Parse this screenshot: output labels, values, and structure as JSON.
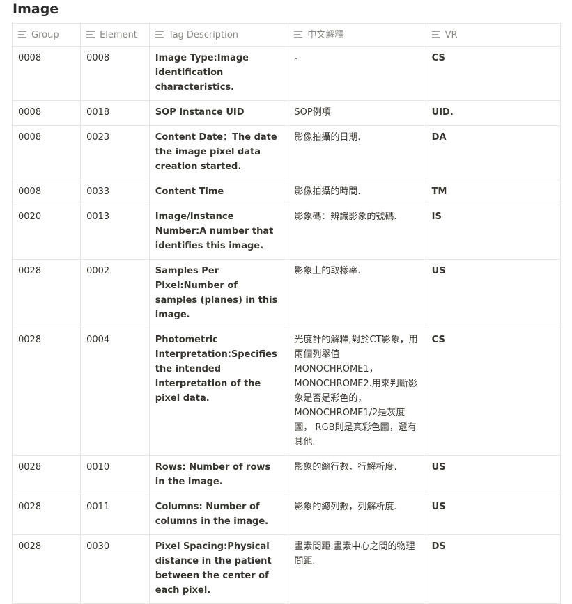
{
  "page": {
    "title": "Image"
  },
  "table": {
    "columns": [
      {
        "label": "Group",
        "icon": "text-property-icon"
      },
      {
        "label": "Element",
        "icon": "text-property-icon"
      },
      {
        "label": "Tag Description",
        "icon": "text-property-icon"
      },
      {
        "label": "中文解釋",
        "icon": "text-property-icon"
      },
      {
        "label": "VR",
        "icon": "text-property-icon"
      }
    ],
    "rows": [
      {
        "group": "0008",
        "element": "0008",
        "description": "Image Type:Image identification characteristics.",
        "chinese": "。",
        "vr": "CS"
      },
      {
        "group": "0008",
        "element": "0018",
        "description": "SOP Instance UID",
        "chinese": "SOP例項",
        "vr": "UID."
      },
      {
        "group": "0008",
        "element": "0023",
        "description": "Content Date：The date the image pixel data creation started.",
        "chinese": "影像拍攝的日期.",
        "vr": "DA"
      },
      {
        "group": "0008",
        "element": "0033",
        "description": "Content Time",
        "chinese": "影像拍攝的時間.",
        "vr": "TM"
      },
      {
        "group": "0020",
        "element": "0013",
        "description": "Image/Instance Number:A number that identifies this image.",
        "chinese": "影象碼：辨識影象的號碼.",
        "vr": "IS"
      },
      {
        "group": "0028",
        "element": "0002",
        "description": "Samples Per Pixel:Number of samples (planes) in this image.",
        "chinese": "影象上的取樣率.",
        "vr": "US"
      },
      {
        "group": "0028",
        "element": "0004",
        "description": "Photometric Interpretation:Specifies the intended interpretation of the pixel data.",
        "chinese": "光度計的解釋,對於CT影象，用兩個列舉值MONOCHROME1，MONOCHROME2.用來判斷影象是否是彩色的，MONOCHROME1/2是灰度圖， RGB則是真彩色圖，還有其他.",
        "vr": "CS"
      },
      {
        "group": "0028",
        "element": "0010",
        "description": "Rows: Number of rows in the image.",
        "chinese": "影象的總行數，行解析度.",
        "vr": "US"
      },
      {
        "group": "0028",
        "element": "0011",
        "description": "Columns: Number of columns in the image.",
        "chinese": "影象的總列數，列解析度.",
        "vr": "US"
      },
      {
        "group": "0028",
        "element": "0030",
        "description": "Pixel Spacing:Physical distance in the patient between the center of each pixel.",
        "chinese": "畫素間距.畫素中心之間的物理間距.",
        "vr": "DS"
      }
    ]
  }
}
